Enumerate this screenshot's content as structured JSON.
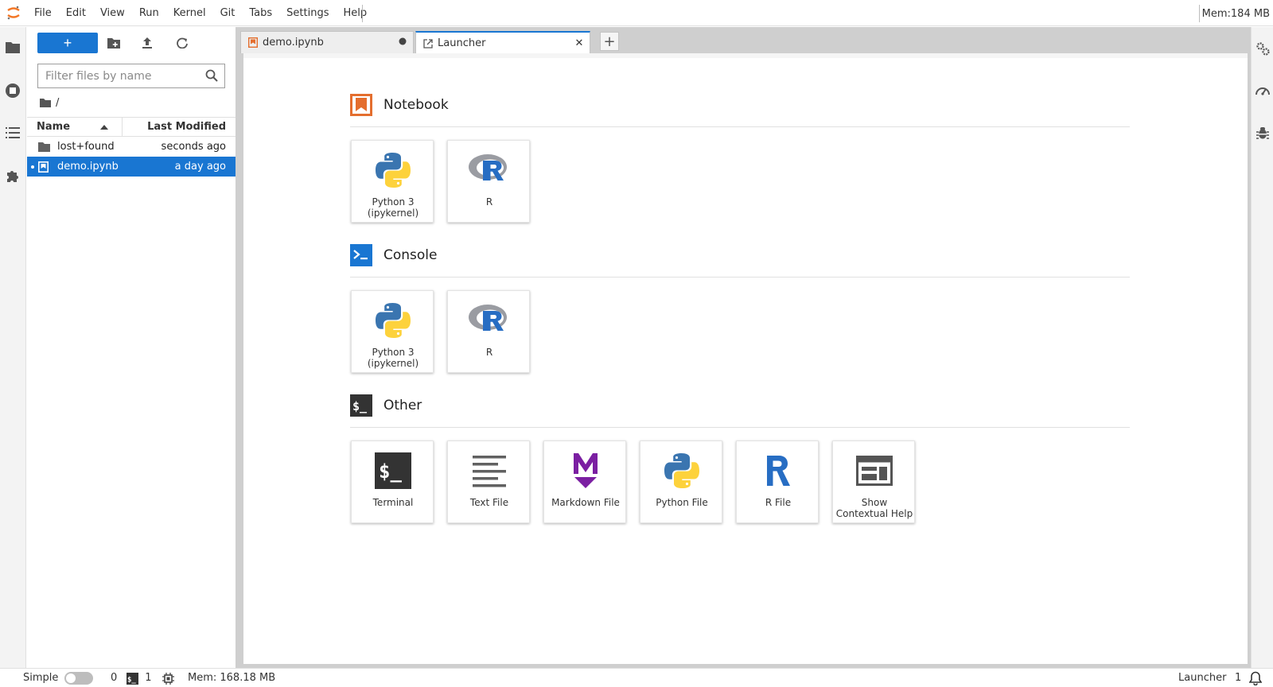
{
  "menu": {
    "items": [
      "File",
      "Edit",
      "View",
      "Run",
      "Kernel",
      "Git",
      "Tabs",
      "Settings",
      "Help"
    ],
    "memory": "Mem:184 MB"
  },
  "file_browser": {
    "new_label": "+",
    "filter_placeholder": "Filter files by name",
    "breadcrumb": "/",
    "columns": {
      "name": "Name",
      "modified": "Last Modified"
    },
    "rows": [
      {
        "name": "lost+found",
        "modified": "seconds ago",
        "type": "folder",
        "selected": false
      },
      {
        "name": "demo.ipynb",
        "modified": "a day ago",
        "type": "notebook",
        "selected": true
      }
    ]
  },
  "tabs": [
    {
      "label": "demo.ipynb",
      "active": false,
      "dirty": true
    },
    {
      "label": "Launcher",
      "active": true,
      "close": "✕"
    }
  ],
  "tab_add": "+",
  "launcher": {
    "sections": [
      {
        "title": "Notebook",
        "cards": [
          {
            "label": "Python 3 (ipykernel)",
            "icon": "python-logo-icon"
          },
          {
            "label": "R",
            "icon": "r-logo-icon"
          }
        ]
      },
      {
        "title": "Console",
        "cards": [
          {
            "label": "Python 3 (ipykernel)",
            "icon": "python-logo-icon"
          },
          {
            "label": "R",
            "icon": "r-logo-icon"
          }
        ]
      },
      {
        "title": "Other",
        "cards": [
          {
            "label": "Terminal",
            "icon": "terminal-icon"
          },
          {
            "label": "Text File",
            "icon": "text-file-icon"
          },
          {
            "label": "Markdown File",
            "icon": "markdown-icon"
          },
          {
            "label": "Python File",
            "icon": "python-logo-icon"
          },
          {
            "label": "R File",
            "icon": "r-letter-icon"
          },
          {
            "label": "Show Contextual Help",
            "icon": "contextual-help-icon"
          }
        ]
      }
    ]
  },
  "status": {
    "mode": "Simple",
    "kernels": "0",
    "terminals": "1",
    "memory": "Mem: 168.18 MB",
    "right_label": "Launcher",
    "notifications": "1"
  },
  "colors": {
    "accent": "#1976d2",
    "notebook_orange": "#e46e2e",
    "console_blue": "#1976d2",
    "markdown_purple": "#7b1fa2",
    "r_blue": "#276dc3"
  }
}
